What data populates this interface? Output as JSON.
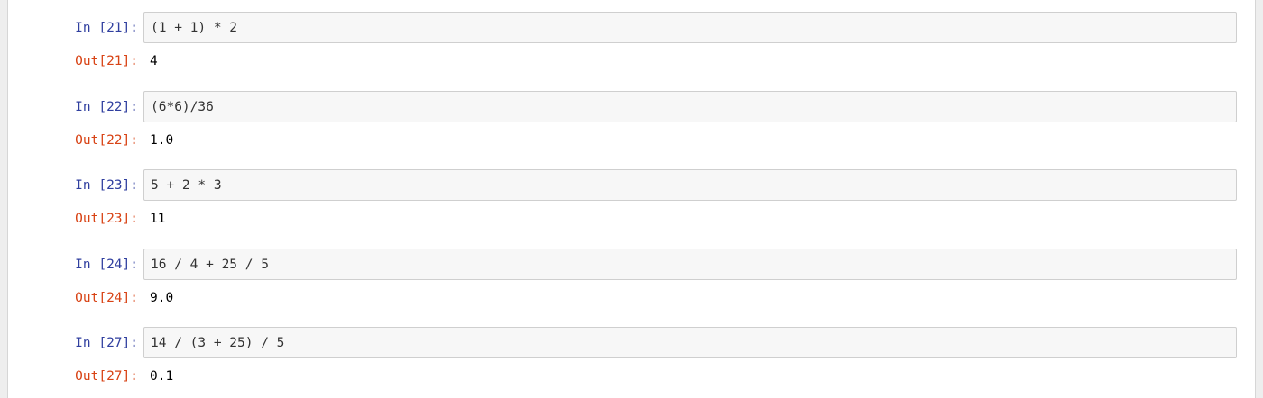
{
  "colors": {
    "in_prompt": "#303f9f",
    "out_prompt": "#d84315",
    "input_background": "#f7f7f7",
    "input_border": "#cfcfcf"
  },
  "cells": [
    {
      "in_label": "In [21]:",
      "code": "(1 + 1) * 2",
      "out_label": "Out[21]:",
      "output": "4"
    },
    {
      "in_label": "In [22]:",
      "code": "(6*6)/36",
      "out_label": "Out[22]:",
      "output": "1.0"
    },
    {
      "in_label": "In [23]:",
      "code": "5 + 2 * 3",
      "out_label": "Out[23]:",
      "output": "11"
    },
    {
      "in_label": "In [24]:",
      "code": "16 / 4 + 25 / 5",
      "out_label": "Out[24]:",
      "output": "9.0"
    },
    {
      "in_label": "In [27]:",
      "code": "14 / (3 + 25) / 5",
      "out_label": "Out[27]:",
      "output": "0.1"
    }
  ]
}
